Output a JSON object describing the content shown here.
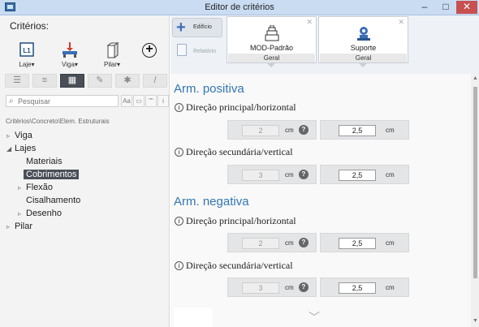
{
  "window": {
    "title": "Editor de critérios",
    "minimize": "–",
    "maximize": "□",
    "close": "✕"
  },
  "left": {
    "title": "Critérios:",
    "tools": [
      {
        "label": "Laje▾",
        "icon": "slab-l1-icon",
        "badge": "L1"
      },
      {
        "label": "Viga▾",
        "icon": "beam-icon"
      },
      {
        "label": "Pilar▾",
        "icon": "column-icon"
      }
    ],
    "add_label": "+",
    "tabs": [
      "☰",
      "≡",
      "▦",
      "✎",
      "✱",
      "/"
    ],
    "search": {
      "placeholder": "Pesquisar",
      "opts": [
        "Aa",
        "▭",
        "\"\"",
        "i"
      ]
    },
    "path": "Critérios\\Concreto\\Elem. Estruturais",
    "tree": [
      {
        "label": "Viga",
        "arrow": "▹",
        "level": 0
      },
      {
        "label": "Lajes",
        "arrow": "◢",
        "level": 0
      },
      {
        "label": "Materiais",
        "arrow": "",
        "level": 1
      },
      {
        "label": "Cobrimentos",
        "arrow": "",
        "level": 1,
        "selected": true
      },
      {
        "label": "Flexão",
        "arrow": "▹",
        "level": 1
      },
      {
        "label": "Cisalhamento",
        "arrow": "",
        "level": 1
      },
      {
        "label": "Desenho",
        "arrow": "▹",
        "level": 1
      },
      {
        "label": "Pilar",
        "arrow": "▹",
        "level": 0
      }
    ]
  },
  "nav": {
    "edificio": "Edifício",
    "relatorio": "Relatório"
  },
  "cards": [
    {
      "name": "MOD-Padrão",
      "group": "Geral",
      "close": "✕"
    },
    {
      "name": "Suporte",
      "group": "Geral",
      "close": "✕"
    }
  ],
  "sections": [
    {
      "title": "Arm. positiva",
      "rows": [
        {
          "label": "Direção principal/horizontal",
          "info": "i",
          "left_value": "2",
          "left_unit": "cm",
          "help": "?",
          "right_value": "2,5",
          "right_unit": "cm"
        },
        {
          "label": "Direção secundária/vertical",
          "info": "i",
          "left_value": "3",
          "left_unit": "cm",
          "help": "?",
          "right_value": "2,5",
          "right_unit": "cm"
        }
      ]
    },
    {
      "title": "Arm. negativa",
      "rows": [
        {
          "label": "Direção principal/horizontal",
          "info": "i",
          "left_value": "2",
          "left_unit": "cm",
          "help": "?",
          "right_value": "2,5",
          "right_unit": "cm"
        },
        {
          "label": "Direção secundária/vertical",
          "info": "i",
          "left_value": "3",
          "left_unit": "cm",
          "help": "?",
          "right_value": "2,5",
          "right_unit": "cm"
        }
      ]
    }
  ],
  "scroll": {
    "up": "▲",
    "down": "▼"
  },
  "more": "﹀",
  "colors": {
    "accent": "#3276b1",
    "titlebar": "#c9dcf2",
    "selected": "#4a4f57",
    "close": "#c75050"
  }
}
